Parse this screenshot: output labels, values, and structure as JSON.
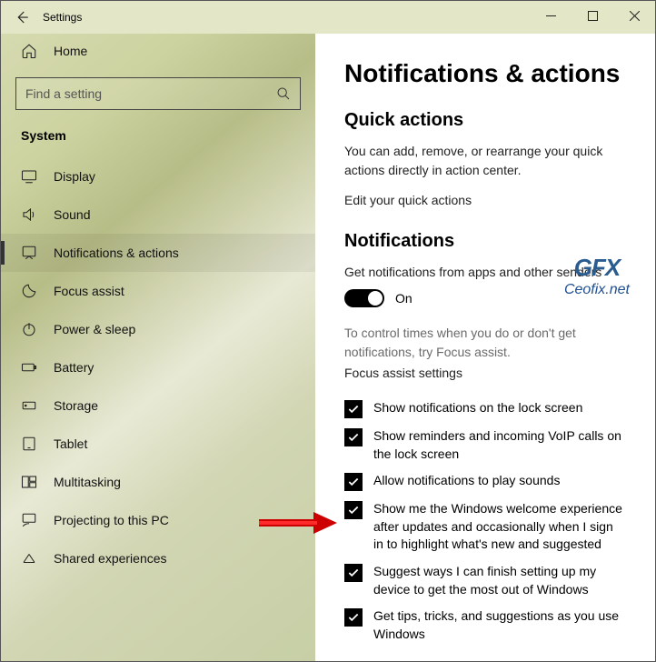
{
  "titlebar": {
    "title": "Settings"
  },
  "sidebar": {
    "home": "Home",
    "search_placeholder": "Find a setting",
    "section": "System",
    "items": [
      {
        "label": "Display"
      },
      {
        "label": "Sound"
      },
      {
        "label": "Notifications & actions"
      },
      {
        "label": "Focus assist"
      },
      {
        "label": "Power & sleep"
      },
      {
        "label": "Battery"
      },
      {
        "label": "Storage"
      },
      {
        "label": "Tablet"
      },
      {
        "label": "Multitasking"
      },
      {
        "label": "Projecting to this PC"
      },
      {
        "label": "Shared experiences"
      }
    ],
    "active_index": 2
  },
  "main": {
    "title": "Notifications & actions",
    "quick_actions_heading": "Quick actions",
    "quick_actions_desc": "You can add, remove, or rearrange your quick actions directly in action center.",
    "edit_link": "Edit your quick actions",
    "notifications_heading": "Notifications",
    "notifications_desc": "Get notifications from apps and other senders",
    "toggle_state": "On",
    "focus_hint": "To control times when you do or don't get notifications, try Focus assist.",
    "focus_link": "Focus assist settings",
    "checks": [
      "Show notifications on the lock screen",
      "Show reminders and incoming VoIP calls on the lock screen",
      "Allow notifications to play sounds",
      "Show me the Windows welcome experience after updates and occasionally when I sign in to highlight what's new and suggested",
      "Suggest ways I can finish setting up my device to get the most out of Windows",
      "Get tips, tricks, and suggestions as you use Windows"
    ]
  },
  "watermark": {
    "line1": "GFX",
    "line2": "Ceofix.net"
  }
}
